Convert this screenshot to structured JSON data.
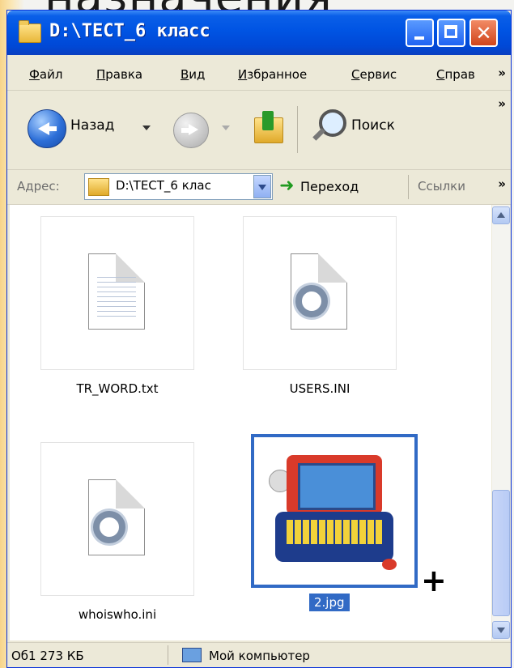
{
  "slide": {
    "title_fragment": "назначения"
  },
  "window": {
    "title": "D:\\ТЕСТ_6 класс",
    "buttons": {
      "minimize": "",
      "maximize": "",
      "close": "✕"
    }
  },
  "menu": {
    "items": [
      "Файл",
      "Правка",
      "Вид",
      "Избранное",
      "Сервис",
      "Справ"
    ],
    "overflow": "»"
  },
  "toolbar": {
    "back_label": "Назад",
    "search_label": "Поиск",
    "overflow": "»"
  },
  "address": {
    "label": "Адрес:",
    "value": "D:\\ТЕСТ_6 клас",
    "go_label": "Переход",
    "links_label": "Ссылки",
    "overflow": "»",
    "go_arrow": "➜"
  },
  "files": [
    {
      "name": "TR_WORD.txt",
      "icon": "text-document-icon"
    },
    {
      "name": "USERS.INI",
      "icon": "settings-document-icon"
    },
    {
      "name": "whoiswho.ini",
      "icon": "settings-document-icon"
    },
    {
      "name": "2.jpg",
      "icon": "image-thumbnail",
      "selected": true
    }
  ],
  "cursor": "+",
  "status": {
    "left": "Об1 273 КБ",
    "right": "Мой компьютер"
  },
  "colors": {
    "titlebar": "#0054e3",
    "selection": "#316ac5",
    "chrome": "#ece9d8"
  }
}
